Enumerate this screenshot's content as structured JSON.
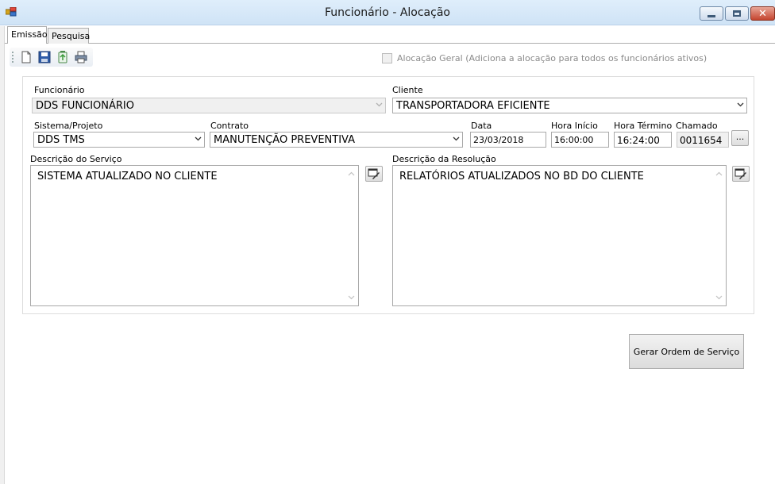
{
  "window": {
    "title": "Funcionário - Alocação",
    "close_glyph": "✕"
  },
  "tabs": [
    {
      "label": "Emissão",
      "active": true
    },
    {
      "label": "Pesquisa",
      "active": false
    }
  ],
  "toolbar": {
    "icons": [
      "new-document-icon",
      "save-icon",
      "recycle-icon",
      "print-icon"
    ]
  },
  "alocacao_geral": {
    "label": "Alocação Geral (Adiciona a alocação para todos os funcionários ativos)",
    "checked": false,
    "enabled": false
  },
  "form": {
    "funcionario": {
      "label": "Funcionário",
      "value": "DDS FUNCIONÁRIO"
    },
    "cliente": {
      "label": "Cliente",
      "value": "TRANSPORTADORA EFICIENTE"
    },
    "sistema": {
      "label": "Sistema/Projeto",
      "value": "DDS TMS"
    },
    "contrato": {
      "label": "Contrato",
      "value": "MANUTENÇÃO PREVENTIVA"
    },
    "data": {
      "label": "Data",
      "value": "23/03/2018"
    },
    "hora_inicio": {
      "label": "Hora Início",
      "value": "16:00:00"
    },
    "hora_termino": {
      "label": "Hora Término",
      "value": "16:24:00"
    },
    "chamado": {
      "label": "Chamado",
      "value": "0011654",
      "button_label": "..."
    },
    "descricao_servico": {
      "label": "Descrição do Serviço",
      "value": "SISTEMA ATUALIZADO NO CLIENTE"
    },
    "descricao_resolucao": {
      "label": "Descrição da Resolução",
      "value": "RELATÓRIOS ATUALIZADOS NO BD DO CLIENTE"
    }
  },
  "actions": {
    "gerar_label": "Gerar Ordem de Serviço"
  },
  "colors": {
    "titlebar": "#cfe3f6",
    "close_button": "#c5452f",
    "form_bg": "#ffffff"
  }
}
